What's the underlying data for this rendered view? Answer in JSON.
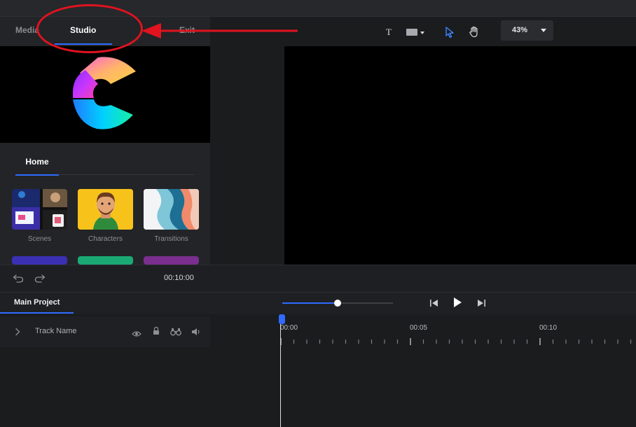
{
  "left_tabs": {
    "media": "Media",
    "studio": "Studio",
    "exit": "Exit"
  },
  "home": {
    "tab_label": "Home"
  },
  "library": [
    {
      "label": "Scenes"
    },
    {
      "label": "Characters"
    },
    {
      "label": "Transitions"
    }
  ],
  "toolbar": {
    "text_tool": "T",
    "zoom": "43%"
  },
  "controls": {
    "total_time": "00:10:00"
  },
  "timeline": {
    "tab_label": "Main Project",
    "track_name": "Track Name",
    "ruler": [
      "00:00",
      "00:05",
      "00:10"
    ],
    "scrub_progress": 0.5
  },
  "colors": {
    "accent": "#2f6bff",
    "annotation": "#e0131f",
    "stage": "#000000"
  }
}
